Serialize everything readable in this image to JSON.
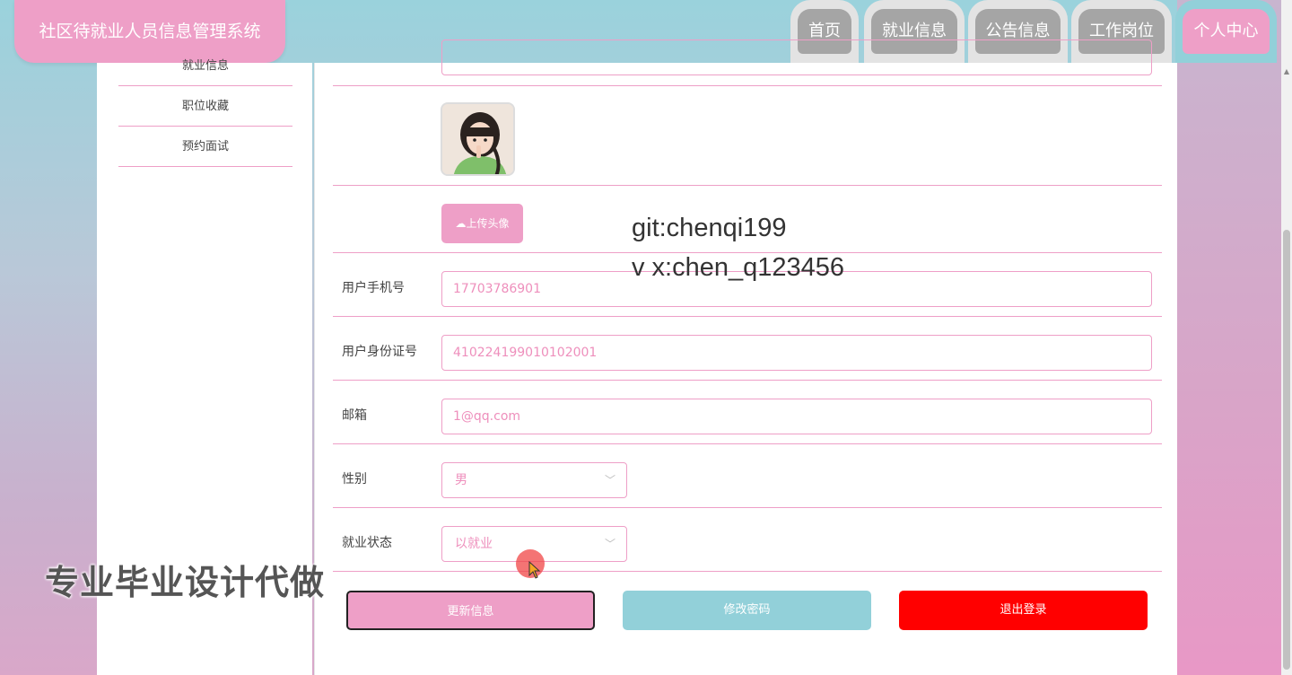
{
  "header": {
    "site_title": "社区待就业人员信息管理系统",
    "nav": [
      {
        "label": "首页"
      },
      {
        "label": "就业信息"
      },
      {
        "label": "公告信息"
      },
      {
        "label": "工作岗位"
      },
      {
        "label": "个人中心",
        "active": true
      }
    ]
  },
  "sidebar": {
    "items": [
      {
        "label": "就业信息"
      },
      {
        "label": "职位收藏"
      },
      {
        "label": "预约面试"
      }
    ]
  },
  "profile": {
    "upload_label": "上传头像",
    "phone": {
      "label": "用户手机号",
      "value": "17703786901"
    },
    "id_card": {
      "label": "用户身份证号",
      "value": "410224199010102001"
    },
    "email": {
      "label": "邮箱",
      "value": "1@qq.com"
    },
    "gender": {
      "label": "性别",
      "value": "男"
    },
    "employment": {
      "label": "就业状态",
      "value": "以就业"
    }
  },
  "actions": {
    "update": "更新信息",
    "change_password": "修改密码",
    "logout": "退出登录"
  },
  "overlay": {
    "line1": "git:chenqi199",
    "line2": "v x:chen_q123456",
    "promo": "专业毕业设计代做"
  },
  "colors": {
    "pink": "#ee9fc7",
    "teal": "#92d0d9",
    "red": "#ff0000"
  }
}
